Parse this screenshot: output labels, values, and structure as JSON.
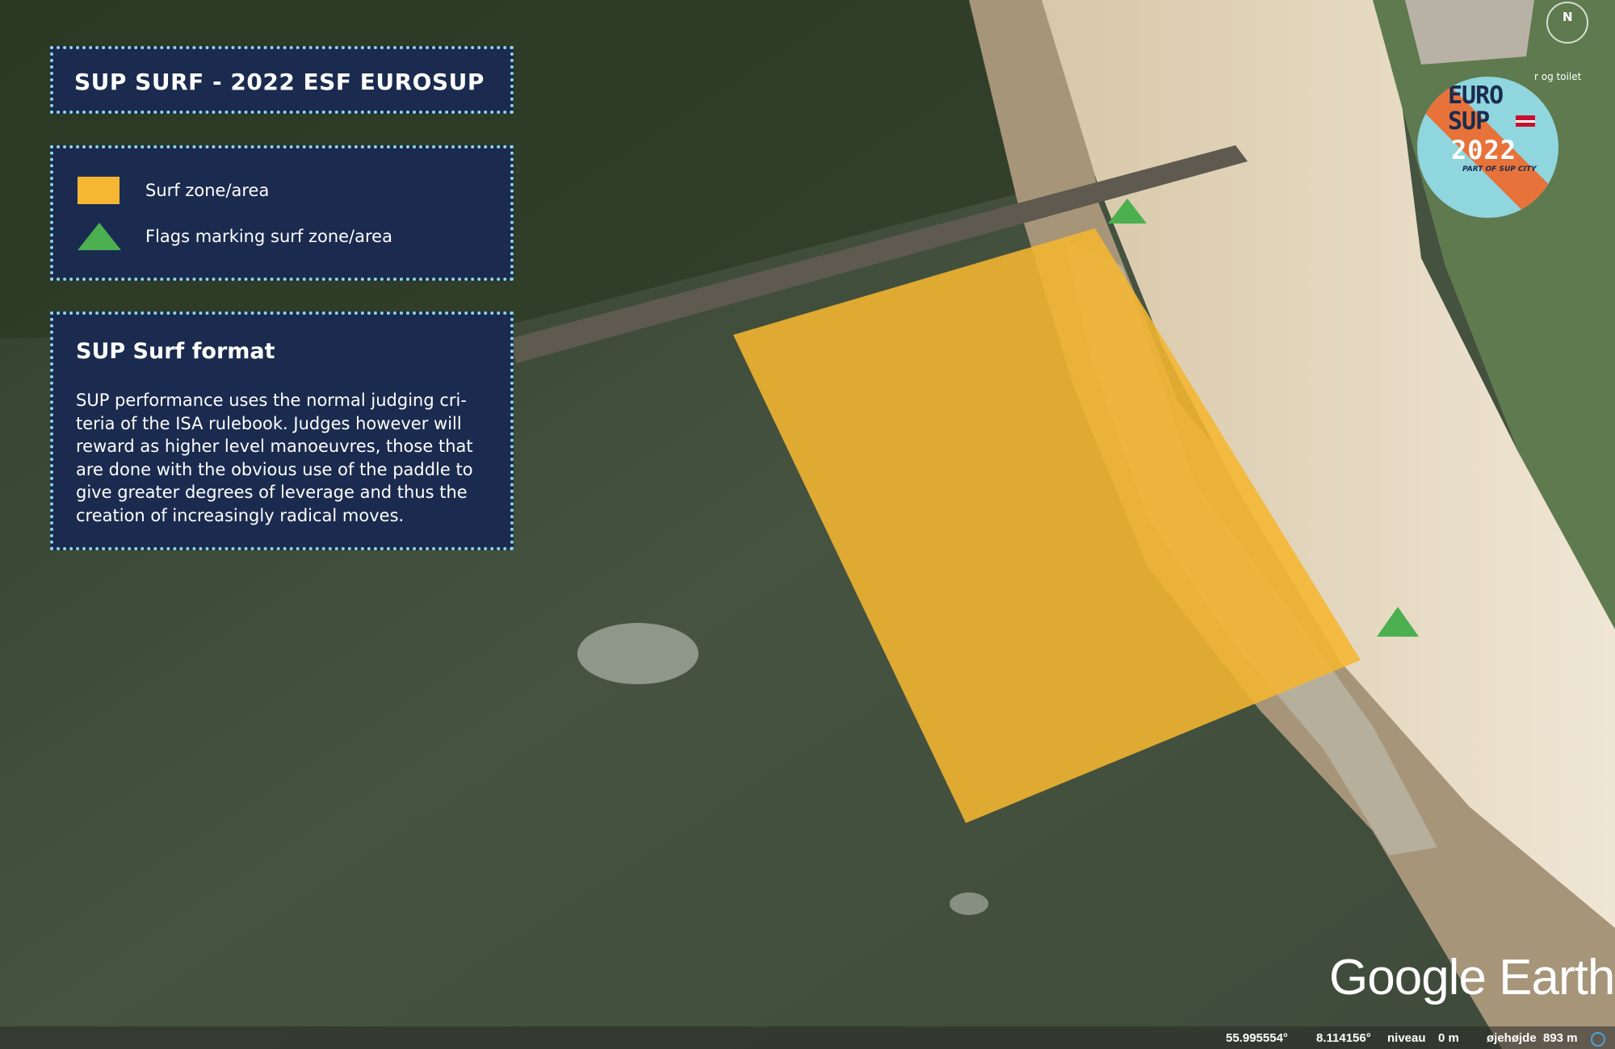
{
  "title": "SUP SURF - 2022 ESF EUROSUP",
  "legend": {
    "items": [
      {
        "label": "Surf zone/area",
        "icon": "yellow-rectangle"
      },
      {
        "label": "Flags marking surf zone/area",
        "icon": "green-triangle"
      }
    ]
  },
  "format": {
    "heading": "SUP Surf format",
    "body": "SUP performance uses the normal judging cri-teria of the ISA rulebook. Judges however will reward as higher level manoeuvres, those that are done with the obvious use of the paddle to give greater degrees of leverage and thus the creation of increasingly radical moves."
  },
  "logo": {
    "line1": "EURO",
    "line2": "SUP",
    "line3": "2022",
    "tagline": "PART OF SUP CITY"
  },
  "map_labels": {
    "toilet": "r og toilet",
    "compass": "N",
    "provider": "Google Earth"
  },
  "status": {
    "lat": "55.995554°",
    "lon": "8.114156°",
    "level_label": "niveau",
    "level_value": "0 m",
    "eye_label": "øjehøjde",
    "eye_value": "893 m"
  },
  "colors": {
    "zone": "#f5b631",
    "flag": "#4caf50",
    "panel": "#1b2b4f",
    "panel_border": "#8fd6e0"
  }
}
